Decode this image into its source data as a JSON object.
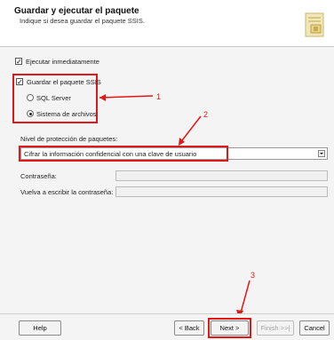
{
  "header": {
    "title": "Guardar y ejecutar el paquete",
    "subtitle": "Indique si desea guardar el paquete SSIS."
  },
  "options": {
    "run_immediately": {
      "label": "Ejecutar inmediatamente",
      "checked": true
    },
    "save_package": {
      "label": "Guardar el paquete SSIS",
      "checked": true
    },
    "destinations": [
      {
        "label": "SQL Server",
        "selected": false
      },
      {
        "label": "Sistema de archivos",
        "selected": true
      }
    ]
  },
  "protection": {
    "label": "Nivel de protección de paquetes:",
    "value": "Cifrar la información confidencial con una clave de usuario",
    "password_label": "Contraseña:",
    "retype_label": "Vuelva a escribir la contraseña:"
  },
  "annotations": [
    "1",
    "2",
    "3"
  ],
  "buttons": {
    "help": "Help",
    "back": "< Back",
    "next": "Next >",
    "finish": "Finish >>|",
    "cancel": "Cancel"
  },
  "colors": {
    "highlight": "#e01818"
  }
}
